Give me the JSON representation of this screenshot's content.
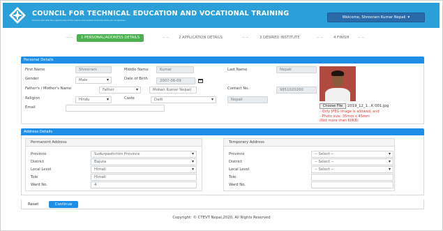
{
  "header": {
    "title": "COUNCIL FOR TECHNICAL EDUCATION AND VOCATIONAL TRAINING",
    "subtitle": "Provide skill with the opportunity of the nation and enable technical skills are recognized",
    "user_menu": "Welcome, Shreeram Kumar Nepali"
  },
  "steps": [
    {
      "label": "1  PERSONAL/ADDRESS DETAILS",
      "active": true
    },
    {
      "label": "2  APPLICATION DETAILS"
    },
    {
      "label": "3  DESIRED INSTITUTE"
    },
    {
      "label": "4  FINISH"
    }
  ],
  "step_separator": "--  --",
  "personal": {
    "section_title": "Personal Details",
    "first_name_label": "First Name",
    "first_name": "Shreeram",
    "middle_name_label": "Middle Name",
    "middle_name": "Kumar",
    "last_name_label": "Last Name",
    "last_name": "Nepali",
    "gender_label": "Gender",
    "gender": "Male",
    "dob_label": "Date of Birth",
    "dob": "2007-06-09",
    "guardian_label": "Father's / Mother's Name",
    "guardian_relation": "Father",
    "guardian_name": "Mohan Kumar Nepali",
    "contact_label": "Contact No.",
    "contact": "9851020200",
    "religion_label": "Religion",
    "religion": "Hindu",
    "caste_label": "Caste",
    "caste": "Dalit",
    "ethnic_group": "Nepali",
    "email_label": "Email",
    "email": "",
    "file_button": "Choose File",
    "file_name": "2019_12_1...K 001.jpg",
    "notes": [
      "- Only JPEG image is allowed, and",
      "- Photo size: 35mm x 45mm",
      "  (Not more than 60KB)"
    ]
  },
  "address": {
    "section_title": "Address Details",
    "permanent_title": "Permanent Address",
    "temporary_title": "Temporary Address",
    "province_label": "Province",
    "district_label": "District",
    "local_label": "Local Level",
    "tole_label": "Tole",
    "ward_label": "Ward No.",
    "perm_province": "Sudurpashchim Province",
    "perm_district": "Bajura",
    "perm_local": "Himali",
    "perm_tole": "Himali",
    "perm_ward": "4",
    "temp_select_placeholder": "-- Select --"
  },
  "actions": {
    "reset": "Reset",
    "continue": "Continue"
  },
  "footer": {
    "copyright": "Copyright: © CTEVT Nepal,2020, All Rights Reserved"
  }
}
